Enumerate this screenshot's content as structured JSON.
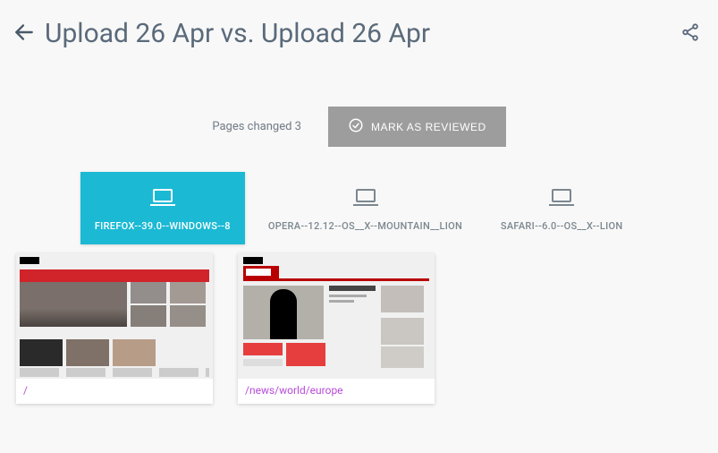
{
  "header": {
    "title": "Upload 26 Apr vs. Upload 26 Apr"
  },
  "status": {
    "pages_changed_text": "Pages changed 3",
    "review_button": "MARK AS REVIEWED"
  },
  "tabs": [
    {
      "label": "FIREFOX--39.0--WINDOWS--8",
      "active": true
    },
    {
      "label": "OPERA--12.12--OS__X--MOUNTAIN__LION",
      "active": false
    },
    {
      "label": "SAFARI--6.0--OS__X--LION",
      "active": false
    }
  ],
  "cards": [
    {
      "path": "/"
    },
    {
      "path": "/news/world/europe"
    }
  ]
}
